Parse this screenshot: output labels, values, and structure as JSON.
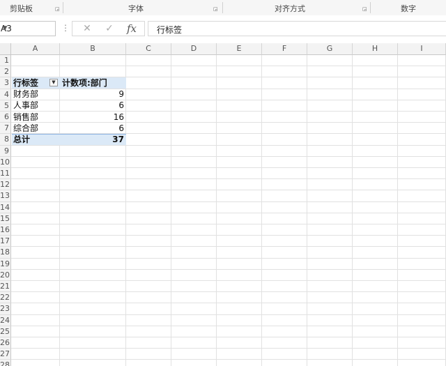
{
  "ribbon": {
    "groups": [
      {
        "label": "剪贴板"
      },
      {
        "label": "字体"
      },
      {
        "label": "对齐方式"
      },
      {
        "label": "数字"
      }
    ]
  },
  "formula_bar": {
    "name_box": "A3",
    "more": "⋮",
    "cancel": "✕",
    "enter": "✓",
    "fx": "fx",
    "content": "行标签"
  },
  "sheet": {
    "columns": [
      "A",
      "B",
      "C",
      "D",
      "E",
      "F",
      "G",
      "H",
      "I"
    ],
    "rows": [
      "1",
      "2",
      "3",
      "4",
      "5",
      "6",
      "7",
      "8",
      "9",
      "10",
      "11",
      "12",
      "13",
      "14",
      "15",
      "16",
      "17",
      "18",
      "19",
      "20",
      "21",
      "22",
      "23",
      "24",
      "25",
      "26",
      "27",
      "28"
    ],
    "pivot": {
      "row_label_header": "行标签",
      "value_header": "计数项:部门",
      "rows": [
        {
          "label": "财务部",
          "value": "9"
        },
        {
          "label": "人事部",
          "value": "6"
        },
        {
          "label": "销售部",
          "value": "16"
        },
        {
          "label": "综合部",
          "value": "6"
        }
      ],
      "total_label": "总计",
      "total_value": "37"
    }
  }
}
